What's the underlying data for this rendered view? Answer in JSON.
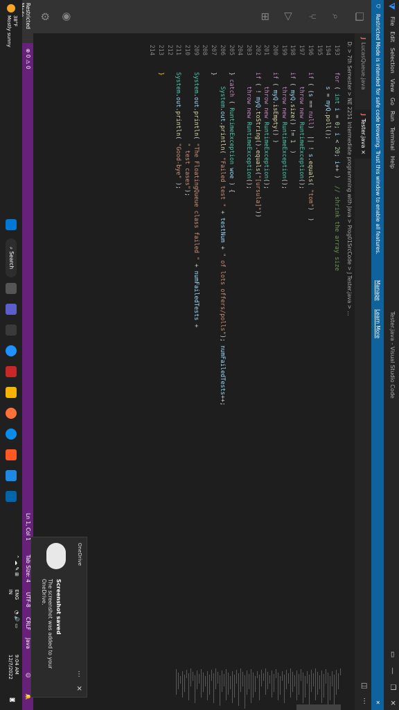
{
  "window": {
    "title": "Tester.java - Visual Studio Code",
    "menu": [
      "File",
      "Edit",
      "Selection",
      "View",
      "Go",
      "Run",
      "Terminal",
      "Help"
    ]
  },
  "banner": {
    "message": "Restricted Mode is intended for safe code browsing. Trust this window to enable all features.",
    "manage": "Manage",
    "learn_more": "Learn More"
  },
  "tabs": [
    {
      "label": "LucasQueue.java",
      "active": false
    },
    {
      "label": "Tester.java",
      "active": true,
      "close": "×"
    }
  ],
  "breadcrumb": "D: > 7th Semester > NE 2251 Intermediate programming with Java > Prog01SrcCode > J Tester.java > ...",
  "code_lines": [
    {
      "num": "193",
      "html": "<span class='kw'>for</span> ( <span class='ty'>int</span> <span class='var'>i</span> = <span class='num'>0</span>; <span class='var'>i</span> &lt; <span class='num'>20</span>; <span class='var'>i</span>++ )  <span class='cm'>// shrink the array size</span>"
    },
    {
      "num": "194",
      "html": "    <span class='var'>s</span> = <span class='var'>myQ</span>.<span class='fn'>poll</span>();"
    },
    {
      "num": "195",
      "html": ""
    },
    {
      "num": "196",
      "html": "<span class='kw'>if</span> ( (<span class='var'>s</span> == <span class='kw'>null</span>)  || ! <span class='var'>s</span>.<span class='fn'>equals</span>( <span class='str'>\"tom\"</span>)  )"
    },
    {
      "num": "197",
      "html": "    <span class='kw'>throw</span> <span class='kw'>new</span> <span class='ty'>RuntimeException</span>();"
    },
    {
      "num": "198",
      "html": "<span class='kw'>if</span> ( <span class='var'>myQ</span>.<span class='fn'>size</span>() != <span class='num'>1</span>  )"
    },
    {
      "num": "199",
      "html": "    <span class='kw'>throw</span> <span class='kw'>new</span> <span class='ty'>RuntimeException</span>();"
    },
    {
      "num": "200",
      "html": "<span class='kw'>if</span> ( <span class='var'>myQ</span>.<span class='fn'>isEmpty</span>() )"
    },
    {
      "num": "201",
      "html": "    <span class='kw'>throw</span> <span class='kw'>new</span> <span class='ty'>RuntimeException</span>();"
    },
    {
      "num": "202",
      "html": "<span class='kw'>if</span> ( ! <span class='var'>myQ</span>.<span class='fn'>toString</span>().<span class='fn'>equals</span>(<span class='str'>\"[ursula]\"</span>))"
    },
    {
      "num": "203",
      "html": "    <span class='kw'>throw</span> <span class='kw'>new</span> <span class='ty'>RuntimeException</span>();"
    },
    {
      "num": "204",
      "html": ""
    },
    {
      "num": "205",
      "html": "} <span class='kw'>catch</span> ( <span class='ty'>RuntimeException</span> <span class='var'>woe</span> ) {"
    },
    {
      "num": "206",
      "html": "    <span class='ty'>System</span>.<span class='var'>out</span>.<span class='fn'>println</span>( <span class='str'>\"Failed test \"</span> + <span class='var'>testNum</span> + <span class='str'>\" of lots offers/polls\"</span>); <span class='var'>numFailedTests</span>++;"
    },
    {
      "num": "207",
      "html": "}"
    },
    {
      "num": "208",
      "html": ""
    },
    {
      "num": "209",
      "html": "<span class='ty'>System</span>.<span class='var'>out</span>.<span class='fn'>println</span>( <span class='str'>\"The FloatingQueue class failed \"</span> + <span class='var'>numFailedTests</span> +"
    },
    {
      "num": "210",
      "html": "                    <span class='str'>\" test cases\"</span>);"
    },
    {
      "num": "211",
      "html": "<span class='ty'>System</span>.<span class='var'>out</span>.<span class='fn'>println</span>( <span class='str'>\"Good-bye\"</span> );"
    },
    {
      "num": "212",
      "html": ""
    },
    {
      "num": "213",
      "html": "<span class='brace'>}</span>"
    },
    {
      "num": "214",
      "html": ""
    }
  ],
  "status": {
    "restricted": "Restricted Mode",
    "problems": "⊗ 0 ⚠ 0",
    "position": "Ln 1, Col 1",
    "tab_size": "Tab Size: 4",
    "encoding": "UTF-8",
    "eol": "CRLF",
    "language": "Java"
  },
  "taskbar": {
    "temp": "38°F",
    "weather": "Mostly sunny",
    "search": "Search",
    "lang1": "ENG",
    "lang2": "IN",
    "time": "9:04 AM",
    "date": "12/7/2022"
  },
  "toast": {
    "app": "OneDrive",
    "title": "Screenshot saved",
    "body": "The screenshot was added to your OneDrive."
  }
}
